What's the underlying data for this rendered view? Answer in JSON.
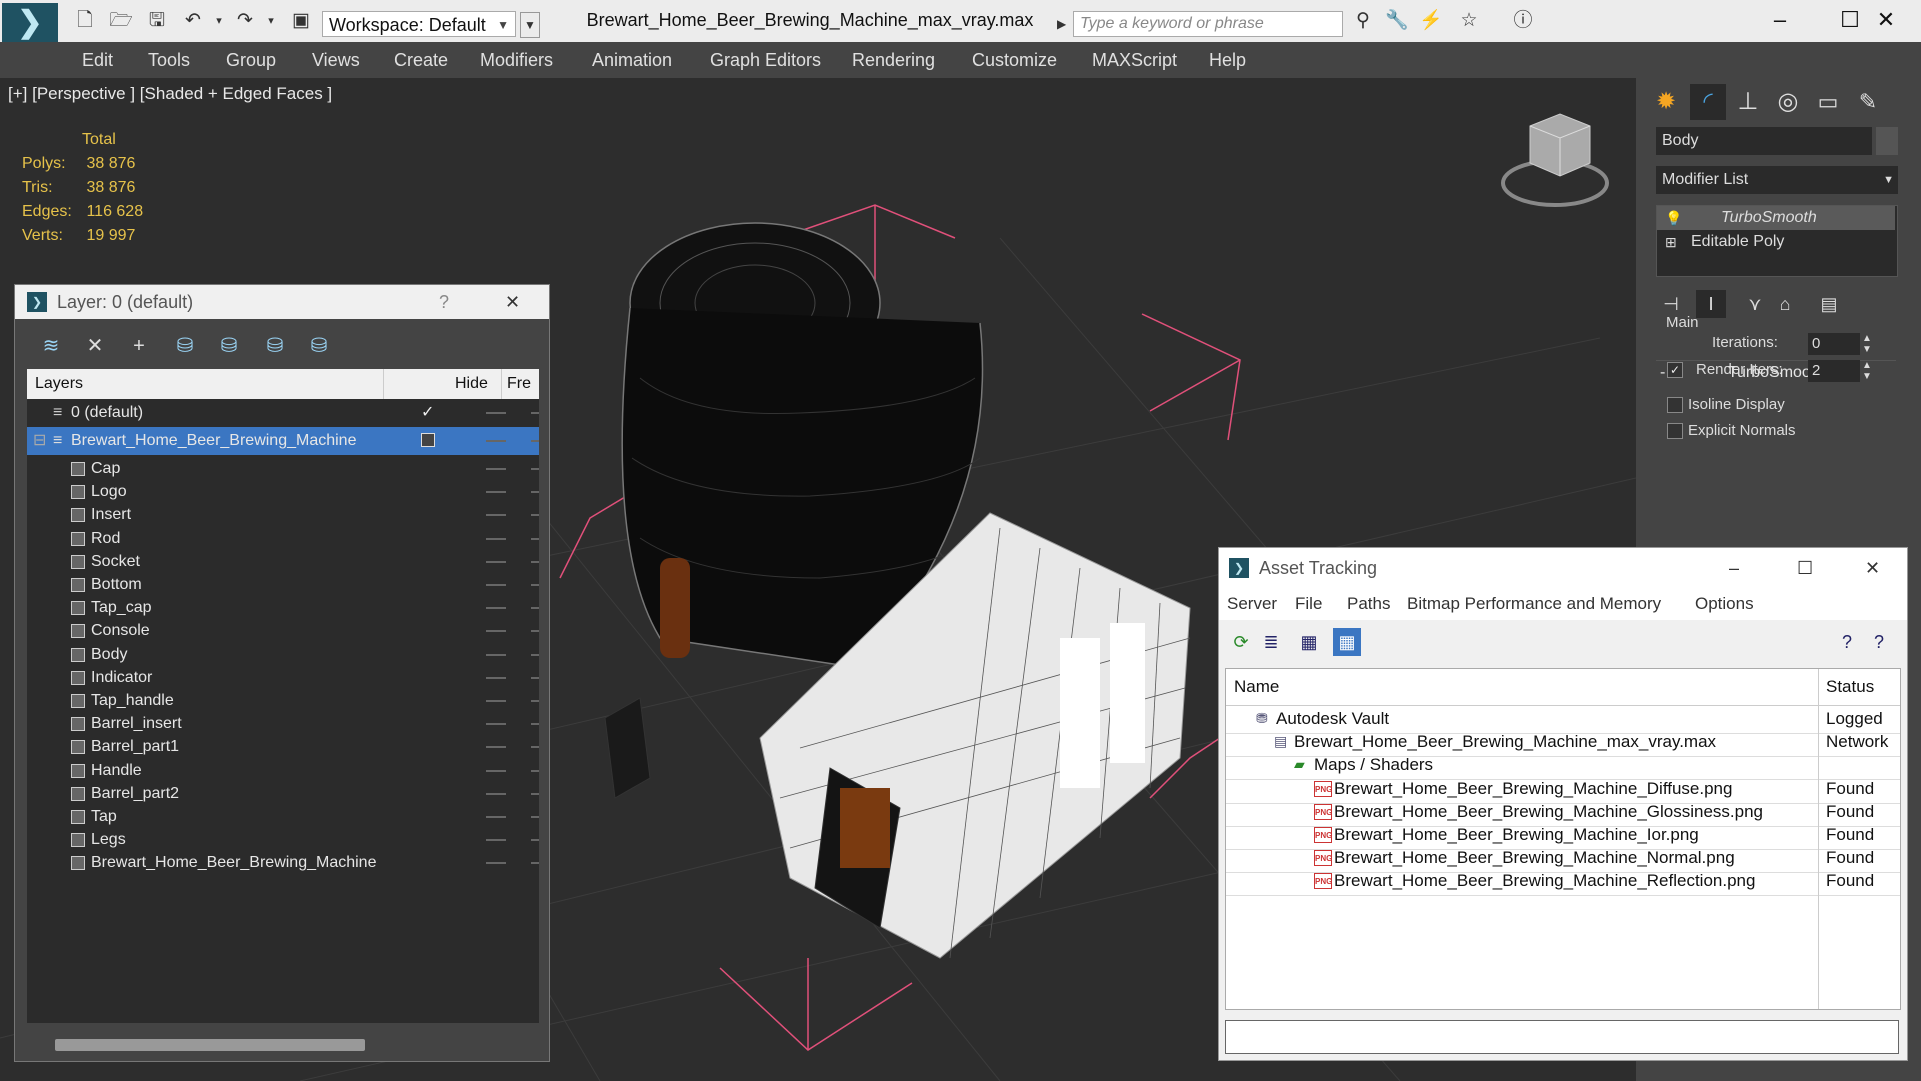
{
  "app": {
    "workspace_label": "Workspace: Default",
    "file_title": "Brewart_Home_Beer_Brewing_Machine_max_vray.max",
    "search_placeholder": "Type a keyword or phrase"
  },
  "menubar": [
    "Edit",
    "Tools",
    "Group",
    "Views",
    "Create",
    "Modifiers",
    "Animation",
    "Graph Editors",
    "Rendering",
    "Customize",
    "MAXScript",
    "Help"
  ],
  "viewport": {
    "label": "[+] [Perspective ] [Shaded + Edged Faces ]",
    "stats": {
      "header": "Total",
      "rows": [
        {
          "label": "Polys:",
          "value": "38 876"
        },
        {
          "label": "Tris:",
          "value": "38 876"
        },
        {
          "label": "Edges:",
          "value": "116 628"
        },
        {
          "label": "Verts:",
          "value": "19 997"
        }
      ]
    }
  },
  "command_panel": {
    "object_name": "Body",
    "modifier_list": "Modifier List",
    "stack": [
      "TurboSmooth",
      "Editable Poly"
    ],
    "rollout_title": "TurboSmooth",
    "group_main": "Main",
    "iterations_label": "Iterations:",
    "iterations_value": "0",
    "render_iters_label": "Render Iters:",
    "render_iters_value": "2",
    "render_iters_checked": "✓",
    "isoline_label": "Isoline Display",
    "explicit_normals_label": "Explicit Normals"
  },
  "layer_dialog": {
    "title": "Layer: 0 (default)",
    "help": "?",
    "close": "✕",
    "columns": {
      "layers": "Layers",
      "hide": "Hide",
      "freeze": "Fre"
    },
    "default_layer": "0 (default)",
    "default_check": "✓",
    "selected_layer": "Brewart_Home_Beer_Brewing_Machine",
    "objects": [
      "Cap",
      "Logo",
      "Insert",
      "Rod",
      "Socket",
      "Bottom",
      "Tap_cap",
      "Console",
      "Body",
      "Indicator",
      "Tap_handle",
      "Barrel_insert",
      "Barrel_part1",
      "Handle",
      "Barrel_part2",
      "Tap",
      "Legs",
      "Brewart_Home_Beer_Brewing_Machine"
    ]
  },
  "asset_tracking": {
    "title": "Asset Tracking",
    "menu": [
      "Server",
      "File",
      "Paths",
      "Bitmap Performance and Memory",
      "Options"
    ],
    "columns": {
      "name": "Name",
      "status": "Status"
    },
    "rows": [
      {
        "name": "Autodesk Vault",
        "status": "Logged"
      },
      {
        "name": "Brewart_Home_Beer_Brewing_Machine_max_vray.max",
        "status": "Network"
      },
      {
        "name": "Maps / Shaders",
        "status": ""
      },
      {
        "name": "Brewart_Home_Beer_Brewing_Machine_Diffuse.png",
        "status": "Found"
      },
      {
        "name": "Brewart_Home_Beer_Brewing_Machine_Glossiness.png",
        "status": "Found"
      },
      {
        "name": "Brewart_Home_Beer_Brewing_Machine_Ior.png",
        "status": "Found"
      },
      {
        "name": "Brewart_Home_Beer_Brewing_Machine_Normal.png",
        "status": "Found"
      },
      {
        "name": "Brewart_Home_Beer_Brewing_Machine_Reflection.png",
        "status": "Found"
      }
    ]
  },
  "icons": {
    "png_badge": "PNG"
  }
}
